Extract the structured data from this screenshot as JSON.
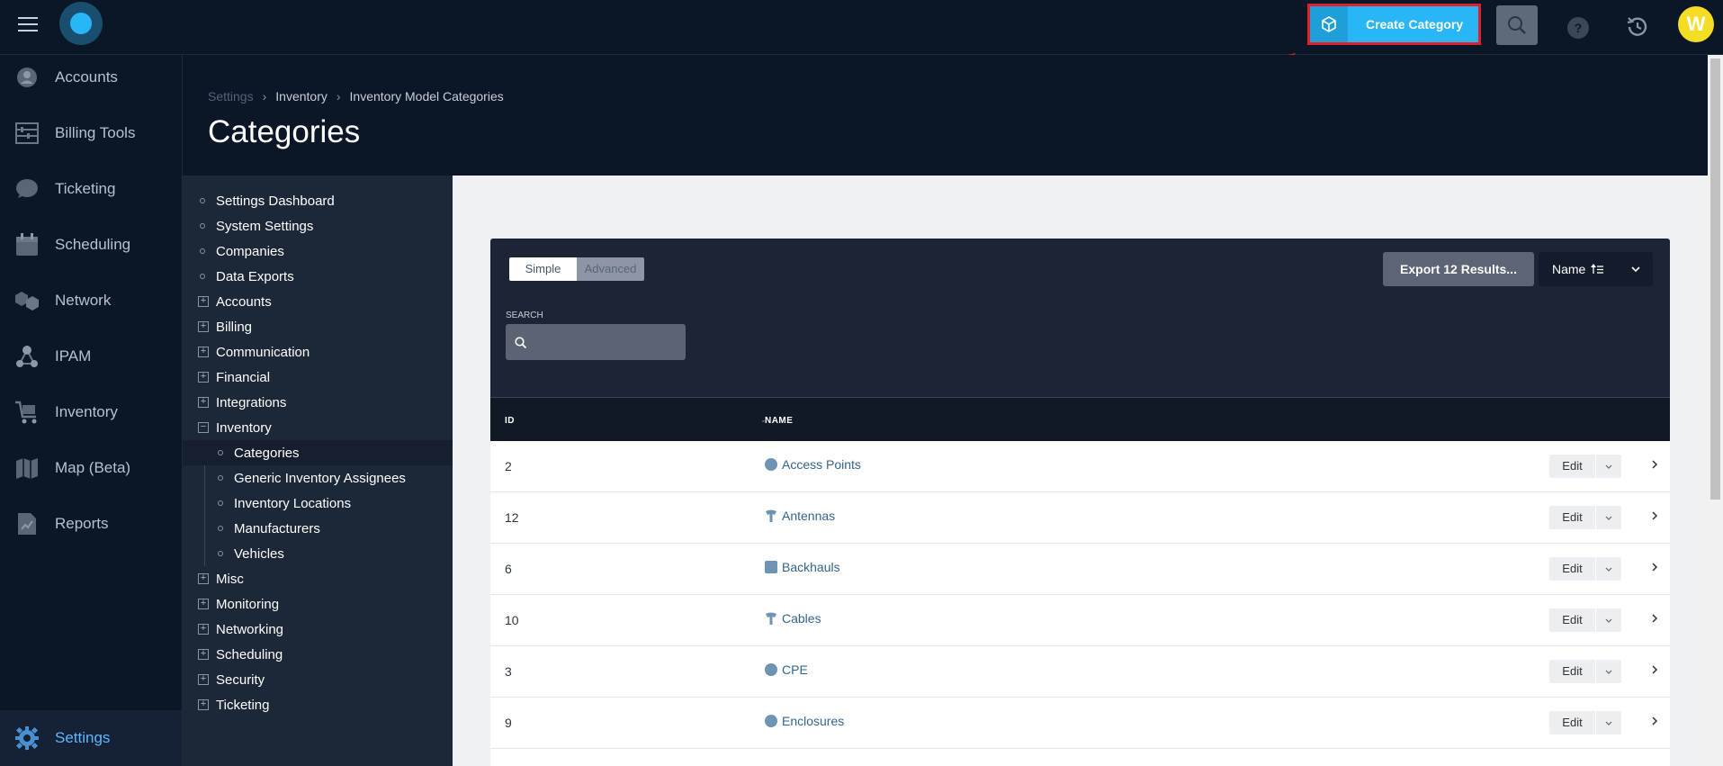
{
  "topbar": {
    "create_button_label": "Create Category",
    "avatar_initial": "W",
    "help_label": "?"
  },
  "sidebar": {
    "items": [
      {
        "label": "Accounts",
        "icon": "user-icon"
      },
      {
        "label": "Billing Tools",
        "icon": "abacus-icon"
      },
      {
        "label": "Ticketing",
        "icon": "chat-bubble-icon"
      },
      {
        "label": "Scheduling",
        "icon": "calendar-icon"
      },
      {
        "label": "Network",
        "icon": "network-icon"
      },
      {
        "label": "IPAM",
        "icon": "nodes-icon"
      },
      {
        "label": "Inventory",
        "icon": "cart-icon"
      },
      {
        "label": "Map (Beta)",
        "icon": "map-icon"
      },
      {
        "label": "Reports",
        "icon": "report-icon"
      },
      {
        "label": "Settings",
        "icon": "gear-icon"
      }
    ]
  },
  "breadcrumb": [
    "Settings",
    "Inventory",
    "Inventory Model Categories"
  ],
  "page_title": "Categories",
  "settings_menu": {
    "items": [
      "Settings Dashboard",
      "System Settings",
      "Companies",
      "Data Exports",
      "Accounts",
      "Billing",
      "Communication",
      "Financial",
      "Integrations",
      "Inventory",
      "Categories",
      "Generic Inventory Assignees",
      "Inventory Locations",
      "Manufacturers",
      "Vehicles",
      "Misc",
      "Monitoring",
      "Networking",
      "Scheduling",
      "Security",
      "Ticketing"
    ],
    "expanded_symbol": "−",
    "collapsed_symbol": "+"
  },
  "filters": {
    "mode_simple": "Simple",
    "mode_advanced": "Advanced",
    "export_label": "Export 12 Results...",
    "sort_label": "Name",
    "search_label": "SEARCH"
  },
  "table": {
    "col_id": "ID",
    "col_name": "NAME",
    "edit_label": "Edit",
    "rows": [
      {
        "id": "2",
        "name": "Access Points",
        "icon": "circle"
      },
      {
        "id": "12",
        "name": "Antennas",
        "icon": "antenna"
      },
      {
        "id": "6",
        "name": "Backhauls",
        "icon": "square"
      },
      {
        "id": "10",
        "name": "Cables",
        "icon": "antenna"
      },
      {
        "id": "3",
        "name": "CPE",
        "icon": "circle"
      },
      {
        "id": "9",
        "name": "Enclosures",
        "icon": "circle"
      }
    ]
  },
  "colors": {
    "accent": "#29b6f6",
    "highlight_border": "#e0202a",
    "link": "#34658e",
    "avatar": "#f5dd25"
  }
}
